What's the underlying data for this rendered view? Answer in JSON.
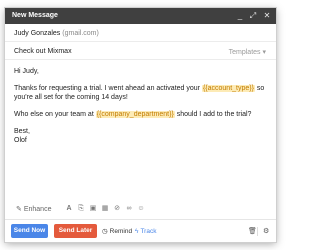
{
  "window": {
    "title": "New Message"
  },
  "to": {
    "name": "Judy Gonzales",
    "email": "(gmail.com)"
  },
  "subject": {
    "text": "Check out Mixmax",
    "templates_label": "Templates ▾"
  },
  "body": {
    "greeting": "Hi Judy,",
    "p1_a": "Thanks for requesting a trial. I went ahead an activated your",
    "p1_var": "{{account_type}}",
    "p1_b": "so you're all set for the coming 14 days!",
    "p2_a": "Who else on your team at",
    "p2_var": "{{company_department}}",
    "p2_b": "should I add to the trial?",
    "closing": "Best,",
    "signature": "Olof"
  },
  "toolbar": {
    "enhance_label": "Enhance"
  },
  "actions": {
    "send_label": "Send Now",
    "send_later_label": "Send Later",
    "remind_label": "Remind",
    "track_label": "Track"
  },
  "colors": {
    "accent_blue": "#4a86e8",
    "send_later": "#e45a3c",
    "title_bar": "#404040",
    "variable_bg": "#fdebb6"
  }
}
